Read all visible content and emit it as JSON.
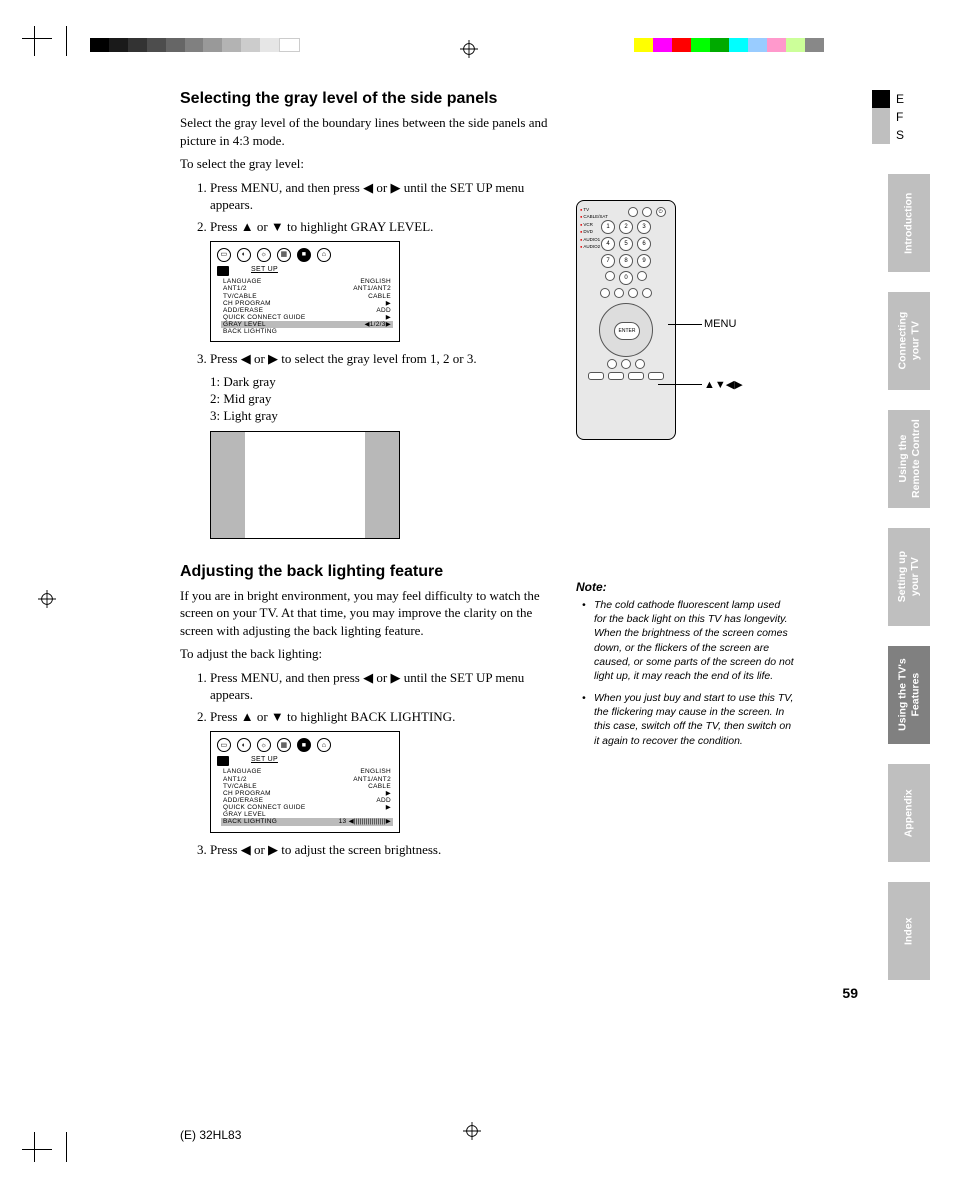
{
  "heading1": "Selecting the gray level of the side panels",
  "para1": "Select the gray level of the boundary lines between the side panels and picture in 4:3 mode.",
  "para2": "To select the gray level:",
  "steps1": {
    "s1a": "Press MENU, and then press ",
    "s1b": " or ",
    "s1c": " until the SET UP menu appears.",
    "s2a": "Press ",
    "s2b": " or ",
    "s2c": " to highlight GRAY LEVEL.",
    "s3a": "Press ",
    "s3b": " or ",
    "s3c": " to select the gray level from 1, 2 or 3."
  },
  "gray_options": {
    "o1": "1: Dark gray",
    "o2": "2: Mid gray",
    "o3": "3: Light gray"
  },
  "osd1": {
    "title": "SET UP",
    "rows": [
      {
        "l": "LANGUAGE",
        "r": "ENGLISH"
      },
      {
        "l": "ANT1/2",
        "r": "ANT1/ANT2"
      },
      {
        "l": "TV/CABLE",
        "r": "CABLE"
      },
      {
        "l": "CH PROGRAM",
        "r": "▶"
      },
      {
        "l": "ADD/ERASE",
        "r": "ADD"
      },
      {
        "l": "QUICK CONNECT GUIDE",
        "r": "▶"
      },
      {
        "l": "GRAY LEVEL",
        "r": "◀1/2/3▶",
        "hl": true
      },
      {
        "l": "BACK LIGHTING",
        "r": ""
      }
    ]
  },
  "heading2": "Adjusting the back lighting feature",
  "para3": "If you are in bright environment, you may feel difficulty to watch the screen on your TV. At that time, you may improve the clarity on the screen with adjusting the back lighting feature.",
  "para4": "To adjust the back lighting:",
  "steps2": {
    "s1a": "Press MENU, and then press ",
    "s1b": " or ",
    "s1c": " until the SET UP menu appears.",
    "s2a": "Press ",
    "s2b": " or ",
    "s2c": " to highlight BACK LIGHTING.",
    "s3a": "Press ",
    "s3b": " or ",
    "s3c": " to adjust the screen brightness."
  },
  "osd2": {
    "title": "SET UP",
    "rows": [
      {
        "l": "LANGUAGE",
        "r": "ENGLISH"
      },
      {
        "l": "ANT1/2",
        "r": "ANT1/ANT2"
      },
      {
        "l": "TV/CABLE",
        "r": "CABLE"
      },
      {
        "l": "CH PROGRAM",
        "r": "▶"
      },
      {
        "l": "ADD/ERASE",
        "r": "ADD"
      },
      {
        "l": "QUICK CONNECT GUIDE",
        "r": "▶"
      },
      {
        "l": "GRAY LEVEL",
        "r": ""
      },
      {
        "l": "BACK LIGHTING",
        "r": "13 ◀||||||||||||||||▶",
        "hl": true
      }
    ]
  },
  "remote": {
    "callout_menu": "MENU",
    "callout_arrows": "▲▼◀▶",
    "enter": "ENTER",
    "side": [
      "TV",
      "CABLE/SAT",
      "VCR",
      "DVD",
      "AUDIO1",
      "AUDIO2"
    ]
  },
  "note": {
    "title": "Note:",
    "n1": "The cold cathode fluorescent lamp used for the back light on this TV has longevity. When the brightness of the screen comes down, or the flickers of the screen are caused, or some parts of the screen do not light up, it may reach the end of its life.",
    "n2": "When you just buy and start to use this TV, the flickering may cause in the screen. In this case, switch off the TV, then switch on it again to recover the condition."
  },
  "lang": {
    "e": "E",
    "f": "F",
    "s": "S"
  },
  "tabs": [
    {
      "label": "Introduction",
      "dark": false
    },
    {
      "label": "Connecting\nyour TV",
      "dark": false
    },
    {
      "label": "Using the\nRemote Control",
      "dark": false
    },
    {
      "label": "Setting up\nyour TV",
      "dark": false
    },
    {
      "label": "Using the TV's\nFeatures",
      "dark": true
    },
    {
      "label": "Appendix",
      "dark": false
    },
    {
      "label": "Index",
      "dark": false
    }
  ],
  "page_number": "59",
  "footer": "(E) 32HL83",
  "glyphs": {
    "left": "◀",
    "right": "▶",
    "up": "▲",
    "down": "▼"
  }
}
